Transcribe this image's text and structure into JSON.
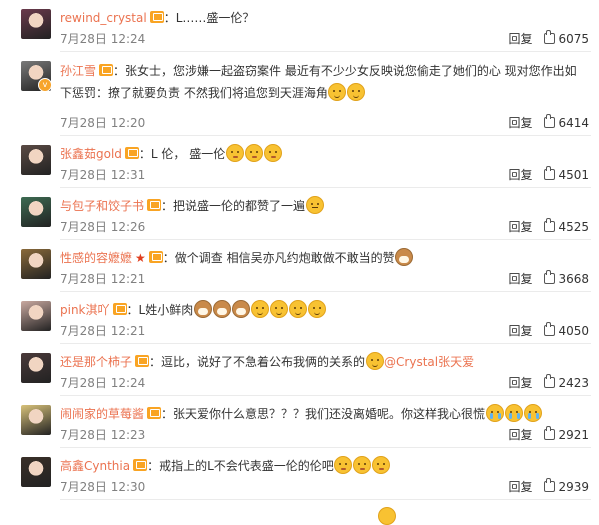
{
  "comments": [
    {
      "user": "rewind_crystal",
      "vip": "",
      "content": "：L……盛一伦？",
      "emojis": [],
      "mention": "",
      "content_after": "",
      "date": "7月28日 12:24",
      "reply": "回复",
      "likes": "6075",
      "avatar": "#6b3a4c",
      "avatar_icon": "avatar-icon",
      "verified": false
    },
    {
      "user": "孙江雪",
      "vip": "",
      "content": "：张女士，您涉嫌一起盗窃案件 最近有不少少女反映说您偷走了她们的心 现对您作出如下惩罚：撩了就要负责 不然我们将追您到天涯海角",
      "emojis": [
        "cat",
        "cat"
      ],
      "mention": "",
      "content_after": "",
      "date": "7月28日 12:20",
      "reply": "回复",
      "likes": "6414",
      "avatar": "#7a7a7a",
      "avatar_icon": "avatar-icon",
      "verified": true
    },
    {
      "user": "张鑫茹gold",
      "vip": "",
      "content": "：L 伦， 盛一伦",
      "emojis": [
        "shy",
        "shy",
        "shy"
      ],
      "mention": "",
      "content_after": "",
      "date": "7月28日 12:31",
      "reply": "回复",
      "likes": "4501",
      "avatar": "#5a4a44",
      "avatar_icon": "avatar-icon",
      "verified": false
    },
    {
      "user": "与包子和饺子书",
      "vip": "",
      "content": "：把说盛一伦的都赞了一遍",
      "emojis": [
        "sleepy"
      ],
      "mention": "",
      "content_after": "",
      "date": "7月28日 12:26",
      "reply": "回复",
      "likes": "4525",
      "avatar": "#3d6b52",
      "avatar_icon": "avatar-icon",
      "verified": false
    },
    {
      "user": "性感的容嬷嬷",
      "vip": "★",
      "content": "：做个调查 相信吴亦凡约炮敢做不敢当的赞",
      "emojis": [
        "dog"
      ],
      "mention": "",
      "content_after": "",
      "date": "7月28日 12:21",
      "reply": "回复",
      "likes": "3668",
      "avatar": "#8a6a3a",
      "avatar_icon": "avatar-icon",
      "verified": false
    },
    {
      "user": "pink淇吖",
      "vip": "",
      "content": "：L姓小鲜肉",
      "emojis": [
        "dog",
        "dog",
        "dog",
        "cat",
        "cat",
        "cat",
        "cat"
      ],
      "mention": "",
      "content_after": "",
      "date": "7月28日 12:21",
      "reply": "回复",
      "likes": "4050",
      "avatar": "#c9a9a0",
      "avatar_icon": "avatar-icon",
      "verified": false
    },
    {
      "user": "还是那个柿子",
      "vip": "",
      "content": "：逗比，说好了不急着公布我俩的关系的",
      "emojis": [
        "cat"
      ],
      "mention": "@Crystal张天爱",
      "content_after": "",
      "date": "7月28日 12:24",
      "reply": "回复",
      "likes": "2423",
      "avatar": "#4a3a3a",
      "avatar_icon": "avatar-icon",
      "verified": false
    },
    {
      "user": "闹闹家的草莓酱",
      "vip": "",
      "content": "：张天爱你什么意思？？？我们还没离婚呢。你这样我心很慌",
      "emojis": [
        "cry",
        "cry",
        "cry"
      ],
      "mention": "",
      "content_after": "",
      "date": "7月28日 12:23",
      "reply": "回复",
      "likes": "2921",
      "avatar": "#d8c27a",
      "avatar_icon": "avatar-icon",
      "verified": false
    },
    {
      "user": "高鑫Cynthia",
      "vip": "",
      "content": "：戒指上的L不会代表盛一伦的伦吧",
      "emojis": [
        "shy",
        "shy",
        "shy"
      ],
      "mention": "",
      "content_after": "",
      "date": "7月28日 12:30",
      "reply": "回复",
      "likes": "2939",
      "avatar": "#3a3028",
      "avatar_icon": "avatar-icon",
      "verified": false
    }
  ],
  "colors": {
    "username": "#eb7350",
    "meta": "#808080",
    "text": "#333333"
  }
}
